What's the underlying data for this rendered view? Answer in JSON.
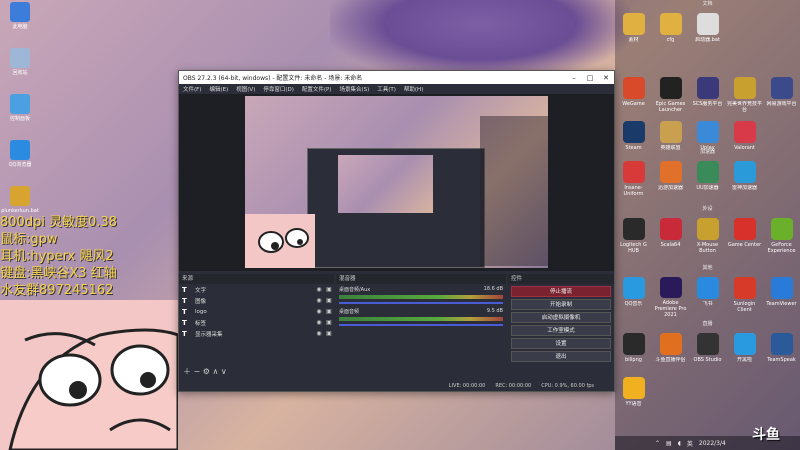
{
  "overlay": {
    "dpi": "800dpi 灵敏度0.38",
    "mouse": "鼠标:gpw",
    "headset": "耳机:hyperx 飓风2",
    "keyboard": "键盘:黑峡谷X3 红轴",
    "fans": "水友群897245162"
  },
  "desktop_left": [
    {
      "label": "此电脑",
      "color": "#3b7dd8"
    },
    {
      "label": "回收站",
      "color": "#9fb7d6"
    },
    {
      "label": "控制面板",
      "color": "#4aa0e0"
    },
    {
      "label": "QQ浏览器",
      "color": "#2a8be0"
    },
    {
      "label": "plunkerkun.bat",
      "color": "#d8a430"
    }
  ],
  "obs": {
    "title": "OBS 27.2.3 (64-bit, windows) - 配置文件: 未命名 - 场景: 未命名",
    "menu": [
      "文件(F)",
      "编辑(E)",
      "视图(V)",
      "停靠窗口(D)",
      "配置文件(P)",
      "场景集合(S)",
      "工具(T)",
      "帮助(H)"
    ],
    "sources_header": "来源",
    "scenes_header": "场景",
    "sources": [
      {
        "name": "文字"
      },
      {
        "name": "图像"
      },
      {
        "name": "logo"
      },
      {
        "name": "标签"
      },
      {
        "name": "显示器采集"
      }
    ],
    "mixer_header": "混音器",
    "mixer": [
      {
        "name": "桌面音频/Aux",
        "db": "18.6 dB"
      },
      {
        "name": "桌面音频",
        "db": "9.5 dB"
      }
    ],
    "controls_header": "控件",
    "controls": [
      "停止播流",
      "开始录制",
      "启动虚拟摄像机",
      "工作室模式",
      "设置",
      "退出"
    ],
    "status": {
      "live": "LIVE: 00:00:00",
      "rec": "REC: 00:00:00",
      "cpu": "CPU: 0.9%, 60.00 fps"
    }
  },
  "right_panel": {
    "sections": [
      {
        "title": "文档",
        "items": [
          {
            "label": "素材",
            "color": "#e0b040"
          },
          {
            "label": "cfg",
            "color": "#e0b040"
          },
          {
            "label": "启动器.bat",
            "color": "#dddddd"
          }
        ]
      },
      {
        "title": "",
        "items": [
          {
            "label": "WeGame",
            "color": "#d84a2a"
          },
          {
            "label": "Epic Games Launcher",
            "color": "#222222"
          },
          {
            "label": "SCS服务平台",
            "color": "#3a3a7a"
          },
          {
            "label": "完美世界竞技平台",
            "color": "#c8a030"
          },
          {
            "label": "网易游戏平台",
            "color": "#3a4a8a"
          },
          {
            "label": "Steam",
            "color": "#1a3a6a"
          },
          {
            "label": "英雄联盟",
            "color": "#c8a050"
          },
          {
            "label": "Uplay",
            "color": "#3a8ad8"
          },
          {
            "label": "Valorant",
            "color": "#d83a4a"
          }
        ]
      },
      {
        "title": "加速器",
        "items": [
          {
            "label": "Insane-Uniform",
            "color": "#d83a3a"
          },
          {
            "label": "迅游加速器",
            "color": "#e0702a"
          },
          {
            "label": "UU加速器",
            "color": "#3a8a5a"
          },
          {
            "label": "雷神加速器",
            "color": "#2a9ad8"
          }
        ]
      },
      {
        "title": "外设",
        "items": [
          {
            "label": "Logitech G HUB",
            "color": "#2a2a2a"
          },
          {
            "label": "Scala64",
            "color": "#c82a3a"
          },
          {
            "label": "X-Mouse Button",
            "color": "#c8a030"
          },
          {
            "label": "Game Center",
            "color": "#d8302a"
          },
          {
            "label": "GeForce Experience",
            "color": "#6ab02a"
          }
        ]
      },
      {
        "title": "其他",
        "items": [
          {
            "label": "QQ音乐",
            "color": "#2a9ae0"
          },
          {
            "label": "Adobe Premiere Pro 2021",
            "color": "#2a1a5a"
          },
          {
            "label": "飞书",
            "color": "#2a8ae0"
          },
          {
            "label": "Sunlogin Client",
            "color": "#d83a2a"
          },
          {
            "label": "TeamViewer",
            "color": "#2a7ad8"
          }
        ]
      },
      {
        "title": "直播",
        "items": [
          {
            "label": "bilipng",
            "color": "#2a2a2a"
          },
          {
            "label": "斗鱼直播伴侣",
            "color": "#e07020"
          },
          {
            "label": "OBS Studio",
            "color": "#333333"
          },
          {
            "label": "开黑啦",
            "color": "#2a9ae0"
          },
          {
            "label": "TeamSpeak",
            "color": "#2a5a9a"
          },
          {
            "label": "YY语音",
            "color": "#f0b020"
          }
        ]
      }
    ]
  },
  "taskbar": {
    "time": "2022/3/4",
    "input": "英"
  },
  "watermark": "斗鱼"
}
